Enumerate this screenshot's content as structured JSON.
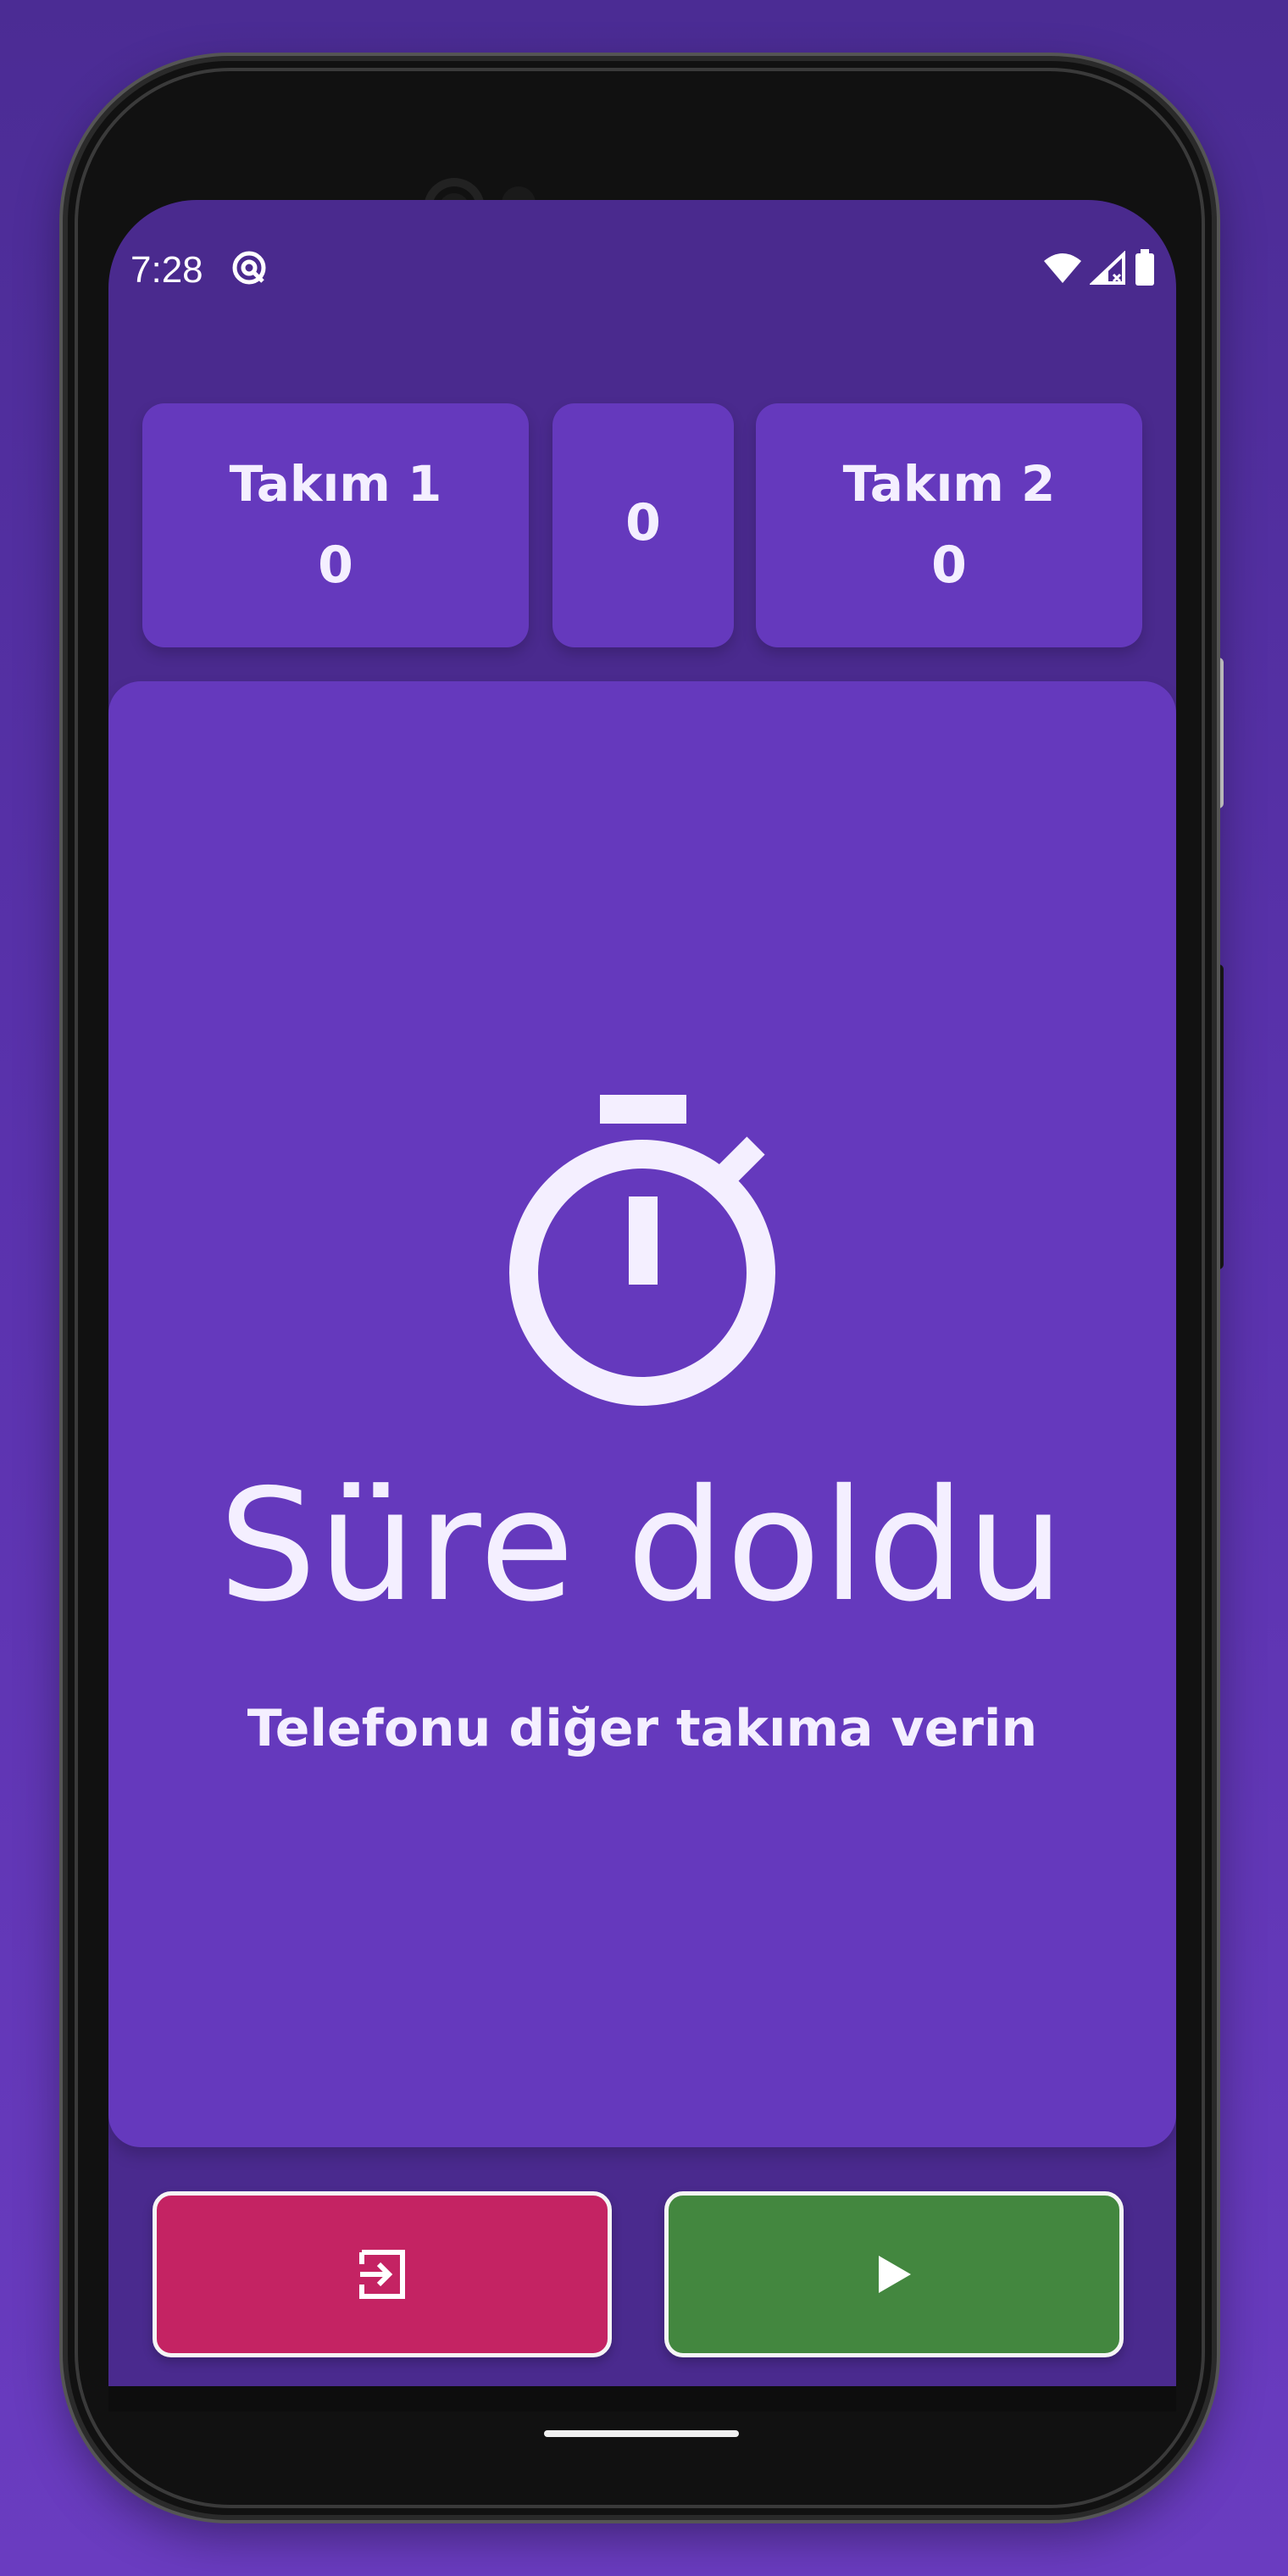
{
  "status_bar": {
    "time": "7:28",
    "app_icon": "at-circle-icon",
    "icons": [
      "wifi-icon",
      "signal-icon",
      "battery-icon"
    ]
  },
  "scoreboard": {
    "team1": {
      "name": "Takım 1",
      "score": "0"
    },
    "round": "0",
    "team2": {
      "name": "Takım 2",
      "score": "0"
    }
  },
  "main": {
    "icon": "stopwatch-icon",
    "title": "Süre doldu",
    "subtitle": "Telefonu diğer takıma verin"
  },
  "actions": {
    "exit_icon": "exit-icon",
    "play_icon": "play-icon"
  },
  "colors": {
    "background": "#4b2c94",
    "card": "#6539bd",
    "exit_button": "#c42363",
    "play_button": "#43873f",
    "text": "#f4efff"
  }
}
